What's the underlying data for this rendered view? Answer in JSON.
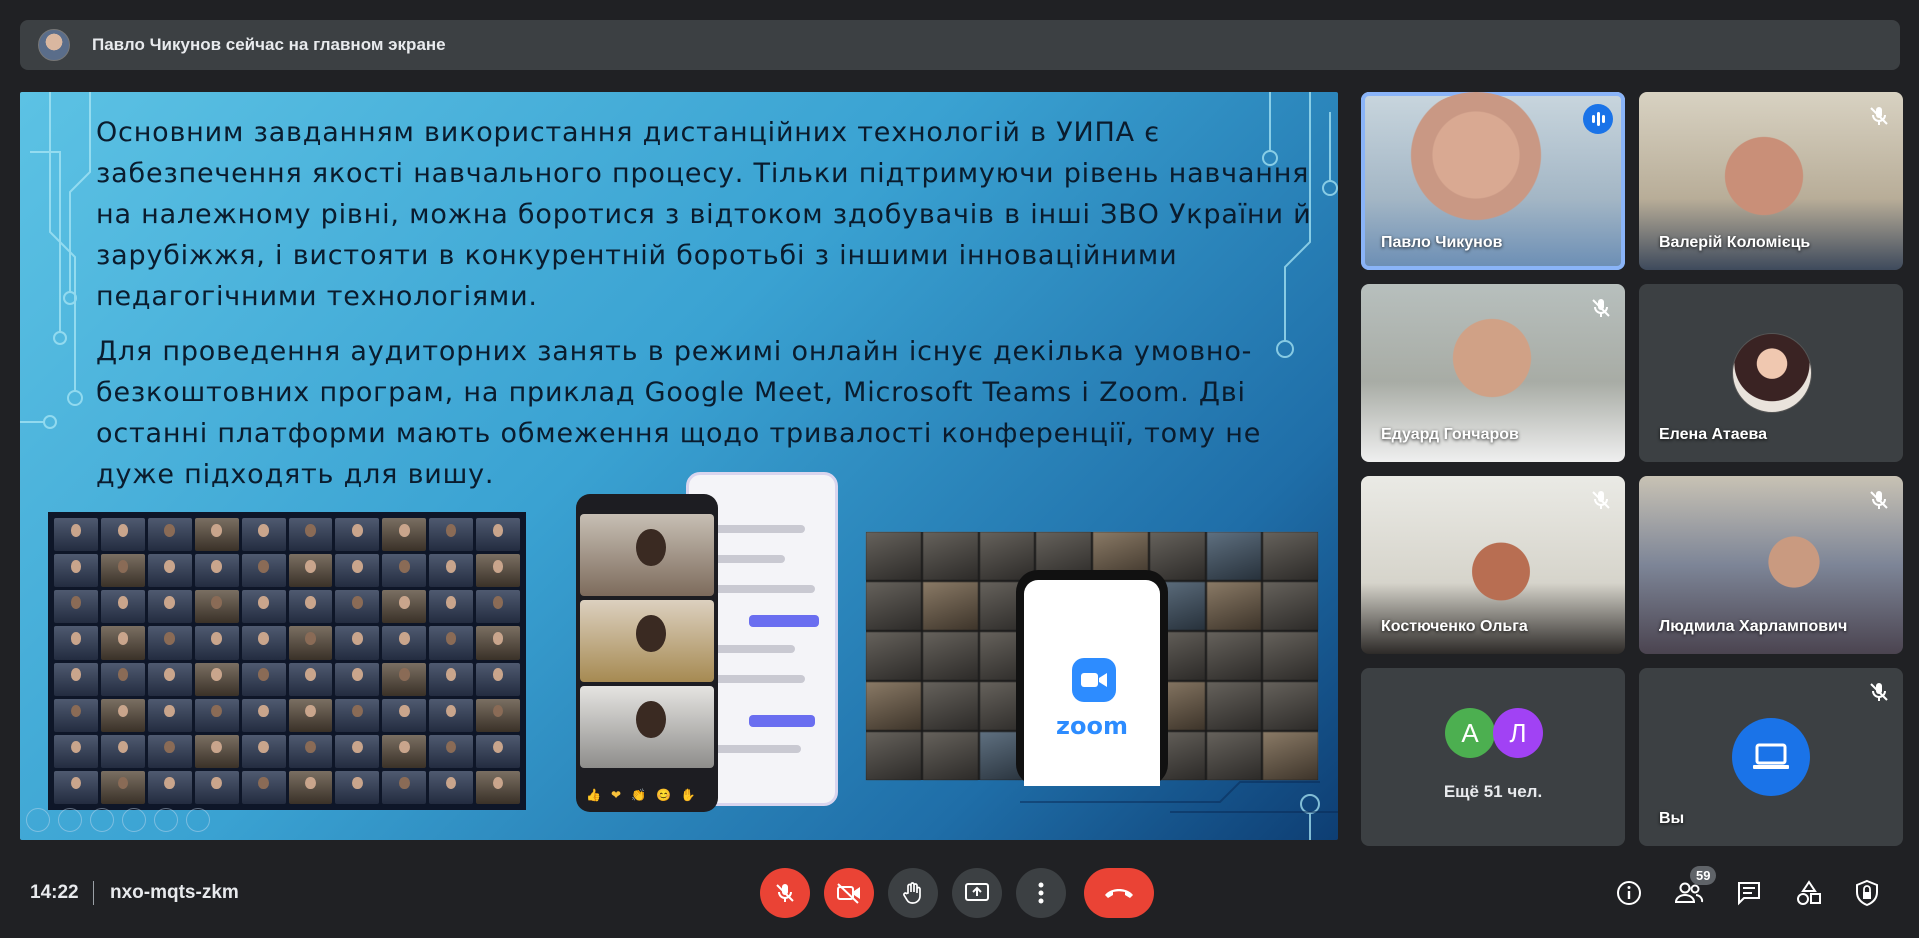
{
  "presenter_bar": {
    "text": "Павло Чикунов сейчас на главном экране"
  },
  "slide": {
    "paragraphs": [
      "Основним завданням використання дистанційних технологій в УИПА є забезпечення якості навчального процесу. Тільки підтримуючи рівень навчання на належному рівні, можна боротися з відтоком здобувачів в інші ЗВО України й зарубіжжя, і вистояти в конкурентній боротьбі з іншими інноваційними педагогічними технологіями.",
      "Для проведення аудиторних занять в режимі онлайн існує декілька умовно-безкоштовних програм, на приклад Google Meet, Microsoft Teams і Zoom. Дві останні платформи мають обмеження щодо тривалості конференції, тому не дуже підходять для вишу."
    ],
    "zoom_logo_text": "zoom"
  },
  "participants": [
    {
      "name": "Павло Чикунов",
      "state": "speaking"
    },
    {
      "name": "Валерій Коломієць",
      "state": "muted"
    },
    {
      "name": "Едуард Гончаров",
      "state": "muted"
    },
    {
      "name": "Елена Атаева",
      "state": "camera-off"
    },
    {
      "name": "Костюченко Ольга",
      "state": "muted"
    },
    {
      "name": "Людмила Харлампович",
      "state": "muted"
    }
  ],
  "more_tile": {
    "initials": [
      "А",
      "Л"
    ],
    "text": "Ещё 51 чел."
  },
  "self_tile": {
    "name": "Вы"
  },
  "bottom_bar": {
    "time": "14:22",
    "meeting_code": "nxo-mqts-zkm",
    "participants_count": "59"
  },
  "colors": {
    "danger": "#ea4335",
    "accent": "#8ab4f8",
    "speaking": "#1a73e8"
  }
}
